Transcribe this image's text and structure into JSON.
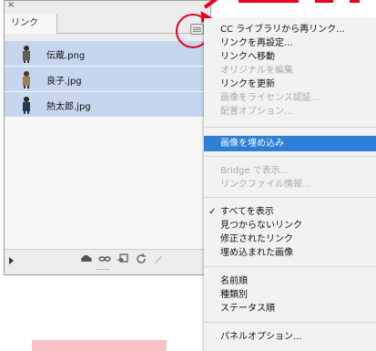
{
  "links_panel": {
    "tab_label": "リンク",
    "close_label": "×",
    "items": [
      {
        "name": "伝蔵.png",
        "color": "#6a5d45"
      },
      {
        "name": "良子.jpg",
        "color": "#a67d55"
      },
      {
        "name": "熱太郎.jpg",
        "color": "#243a52"
      }
    ],
    "bottom_icons": [
      "relink-cc-icon",
      "link-icon",
      "go-to-link-icon",
      "update-icon",
      "edit-icon"
    ]
  },
  "context_menu": {
    "items": [
      {
        "label": "CC ライブラリから再リンク...",
        "state": "normal"
      },
      {
        "label": "リンクを再設定...",
        "state": "normal"
      },
      {
        "label": "リンクへ移動",
        "state": "normal"
      },
      {
        "label": "オリジナルを編集",
        "state": "disabled"
      },
      {
        "label": "リンクを更新",
        "state": "normal"
      },
      {
        "label": "画像をライセンス認証...",
        "state": "disabled"
      },
      {
        "label": "配置オプション...",
        "state": "disabled"
      },
      {
        "label": "画像を埋め込み",
        "state": "selected"
      },
      {
        "label": "Bridge で表示...",
        "state": "disabled"
      },
      {
        "label": "リンクファイル情報...",
        "state": "disabled"
      },
      {
        "label": "すべてを表示",
        "state": "checked",
        "check": "✓"
      },
      {
        "label": "見つからないリンク",
        "state": "normal"
      },
      {
        "label": "修正されたリンク",
        "state": "normal"
      },
      {
        "label": "埋め込まれた画像",
        "state": "normal"
      },
      {
        "label": "名前順",
        "state": "normal"
      },
      {
        "label": "種類別",
        "state": "normal"
      },
      {
        "label": "ステータス順",
        "state": "normal"
      },
      {
        "label": "パネルオプション...",
        "state": "normal"
      }
    ]
  },
  "colors": {
    "accent": "#e8001c",
    "selection_blue": "#2d7ed6",
    "row_highlight": "#c5d6ee"
  }
}
